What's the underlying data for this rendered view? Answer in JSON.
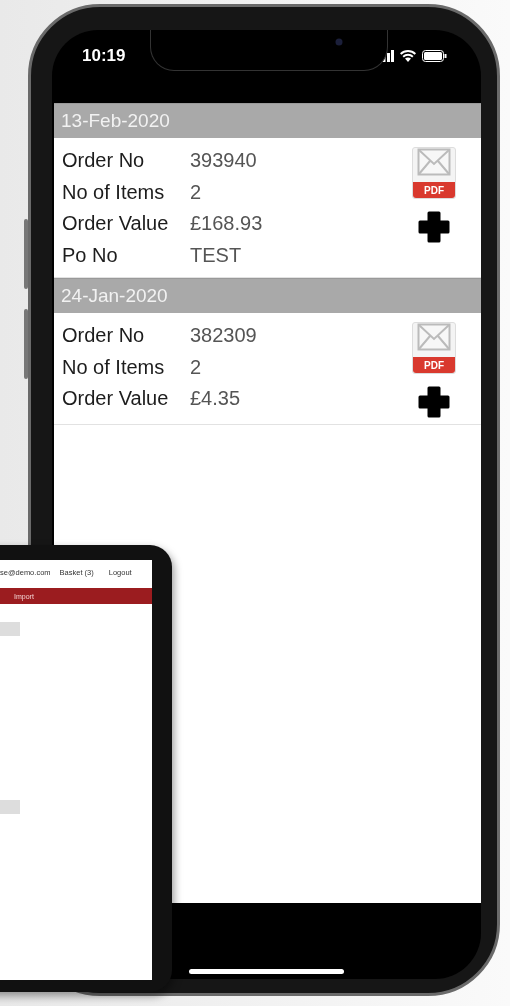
{
  "status_bar": {
    "time": "10:19"
  },
  "orders": [
    {
      "date": "13-Feb-2020",
      "pdf_label": "PDF",
      "fields": [
        {
          "label": "Order No",
          "value": "393940"
        },
        {
          "label": "No of Items",
          "value": "2"
        },
        {
          "label": "Order Value",
          "value": "£168.93"
        },
        {
          "label": "Po No",
          "value": "TEST"
        }
      ]
    },
    {
      "date": "24-Jan-2020",
      "pdf_label": "PDF",
      "fields": [
        {
          "label": "Order No",
          "value": "382309"
        },
        {
          "label": "No of Items",
          "value": "2"
        },
        {
          "label": "Order Value",
          "value": "£4.35"
        }
      ]
    }
  ],
  "laptop": {
    "header_links": [
      "se@demo.com",
      "Basket (3)",
      "Logout"
    ],
    "nav_items": [
      "Import"
    ]
  }
}
